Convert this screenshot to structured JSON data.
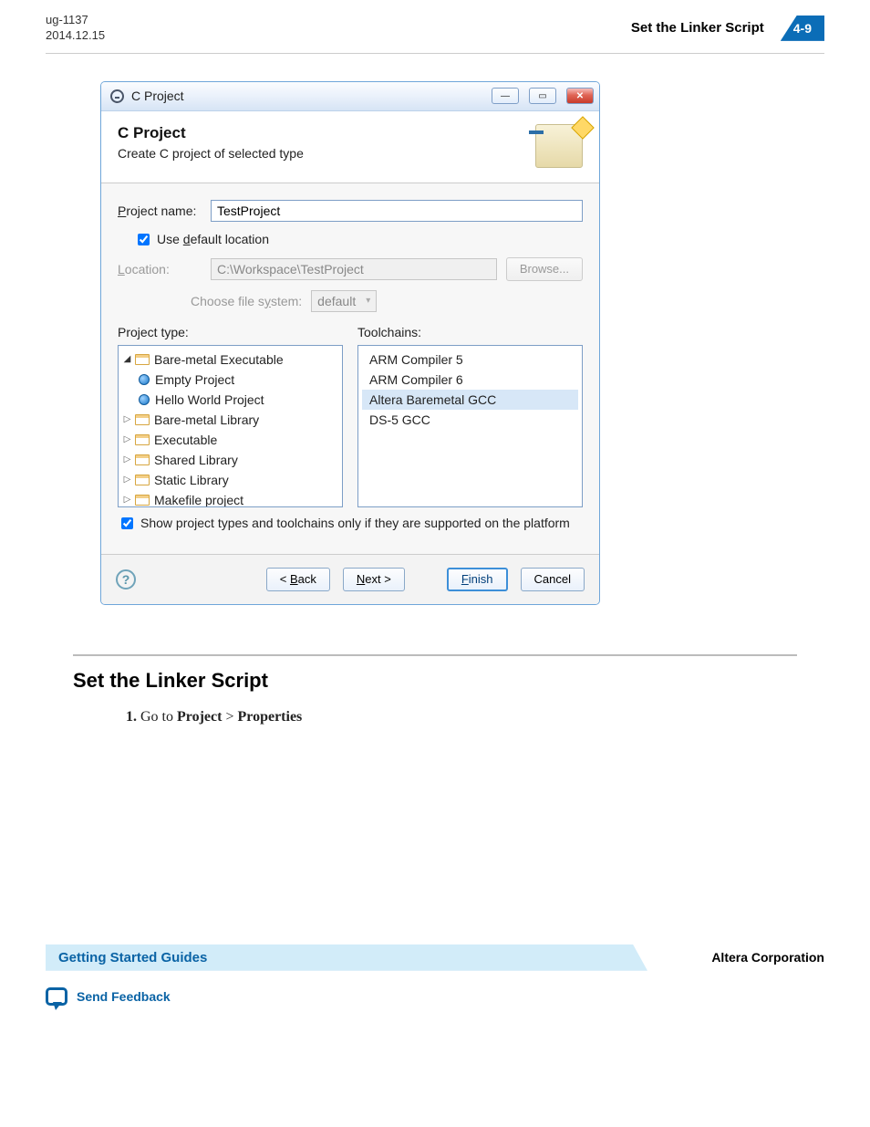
{
  "header": {
    "doc_id": "ug-1137",
    "doc_date": "2014.12.15",
    "title": "Set the Linker Script",
    "page_label": "4-9"
  },
  "dialog": {
    "window_title": "C Project",
    "head_title": "C Project",
    "head_sub": "Create C project of selected type",
    "project_name_label": "Project name:",
    "project_name_value": "TestProject",
    "use_default_label": "Use default location",
    "use_default_checked": true,
    "location_label": "Location:",
    "location_value": "C:\\Workspace\\TestProject",
    "browse_label": "Browse...",
    "fs_label": "Choose file system:",
    "fs_value": "default",
    "project_type_label": "Project type:",
    "toolchains_label": "Toolchains:",
    "tree": {
      "n0": "Bare-metal Executable",
      "n0a": "Empty Project",
      "n0b": "Hello World Project",
      "n1": "Bare-metal Library",
      "n2": "Executable",
      "n3": "Shared Library",
      "n4": "Static Library",
      "n5": "Makefile project"
    },
    "toolchains": {
      "t0": "ARM Compiler 5",
      "t1": "ARM Compiler 6",
      "t2": "Altera Baremetal GCC",
      "t3": "DS-5 GCC"
    },
    "supported_label": "Show project types and toolchains only if they are supported on the platform",
    "supported_checked": true,
    "buttons": {
      "back": "< Back",
      "next": "Next >",
      "finish": "Finish",
      "cancel": "Cancel"
    }
  },
  "doc": {
    "h2": "Set the Linker Script",
    "step_num": "1.",
    "step_pre": "Go to ",
    "step_b1": "Project",
    "step_sep": " > ",
    "step_b2": "Properties"
  },
  "footer": {
    "guides": "Getting Started Guides",
    "corp": "Altera Corporation",
    "feedback": "Send Feedback"
  }
}
